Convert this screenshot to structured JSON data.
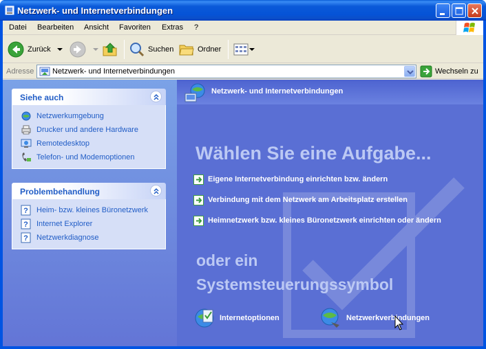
{
  "window": {
    "title": "Netzwerk- und Internetverbindungen"
  },
  "menubar": {
    "items": [
      "Datei",
      "Bearbeiten",
      "Ansicht",
      "Favoriten",
      "Extras",
      "?"
    ]
  },
  "toolbar": {
    "back_label": "Zurück",
    "search_label": "Suchen",
    "folders_label": "Ordner"
  },
  "addressbar": {
    "label": "Adresse",
    "value": "Netzwerk- und Internetverbindungen",
    "go_label": "Wechseln zu"
  },
  "sidebar": {
    "see_also": {
      "title": "Siehe auch",
      "items": [
        {
          "label": "Netzwerkumgebung",
          "icon": "network-places-icon"
        },
        {
          "label": "Drucker und andere Hardware",
          "icon": "printer-icon"
        },
        {
          "label": "Remotedesktop",
          "icon": "remote-desktop-icon"
        },
        {
          "label": "Telefon- und Modemoptionen",
          "icon": "phone-icon"
        }
      ]
    },
    "troubleshoot": {
      "title": "Problembehandlung",
      "items": [
        {
          "label": "Heim- bzw. kleines Büronetzwerk",
          "icon": "help-icon"
        },
        {
          "label": "Internet Explorer",
          "icon": "help-icon"
        },
        {
          "label": "Netzwerkdiagnose",
          "icon": "help-icon"
        }
      ]
    }
  },
  "main": {
    "header_title": "Netzwerk- und Internetverbindungen",
    "task_heading": "Wählen Sie eine Aufgabe...",
    "tasks": [
      "Eigene Internetverbindung einrichten bzw. ändern",
      "Verbindung mit dem Netzwerk am Arbeitsplatz erstellen",
      "Heimnetzwerk bzw. kleines Büronetzwerk einrichten oder ändern"
    ],
    "or_heading_line1": "oder ein",
    "or_heading_line2": "Systemsteuerungssymbol",
    "cp_items": [
      {
        "label": "Internetoptionen",
        "icon": "internet-options-icon"
      },
      {
        "label": "Netzwerkverbindungen",
        "icon": "network-connections-icon"
      }
    ]
  },
  "colors": {
    "titlebar": "#0054e3",
    "left_pane": "#7ba2e7",
    "right_pane": "#5a6fd4",
    "link": "#215dc6"
  }
}
